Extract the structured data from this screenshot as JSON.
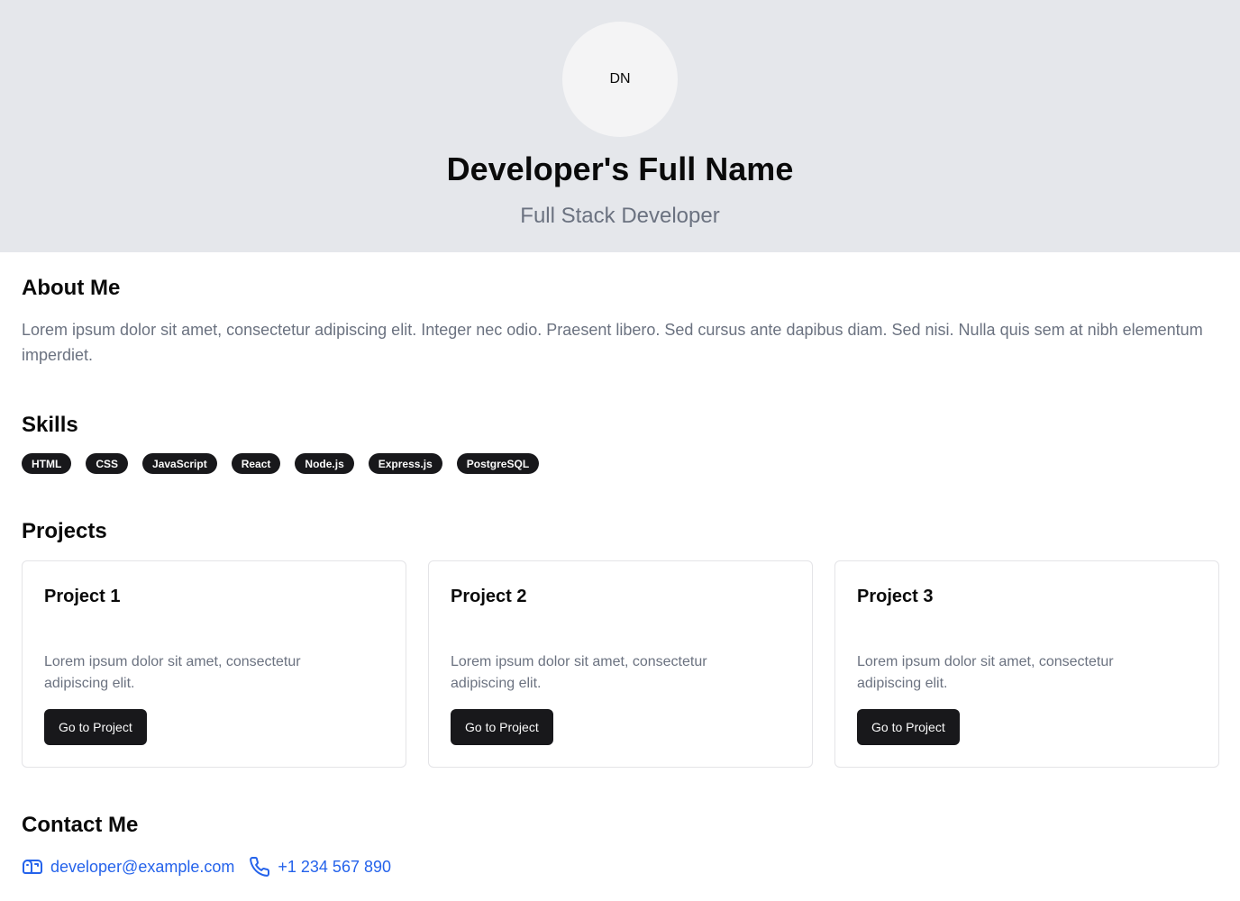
{
  "header": {
    "avatar_initials": "DN",
    "name": "Developer's Full Name",
    "role": "Full Stack Developer"
  },
  "about": {
    "title": "About Me",
    "text": "Lorem ipsum dolor sit amet, consectetur adipiscing elit. Integer nec odio. Praesent libero. Sed cursus ante dapibus diam. Sed nisi. Nulla quis sem at nibh elementum imperdiet."
  },
  "skills": {
    "title": "Skills",
    "items": [
      "HTML",
      "CSS",
      "JavaScript",
      "React",
      "Node.js",
      "Express.js",
      "PostgreSQL"
    ]
  },
  "projects": {
    "title": "Projects",
    "items": [
      {
        "title": "Project 1",
        "description": "Lorem ipsum dolor sit amet, consectetur adipiscing elit.",
        "button_label": "Go to Project"
      },
      {
        "title": "Project 2",
        "description": "Lorem ipsum dolor sit amet, consectetur adipiscing elit.",
        "button_label": "Go to Project"
      },
      {
        "title": "Project 3",
        "description": "Lorem ipsum dolor sit amet, consectetur adipiscing elit.",
        "button_label": "Go to Project"
      }
    ]
  },
  "contact": {
    "title": "Contact Me",
    "email": "developer@example.com",
    "email_icon": "mailbox-icon",
    "phone": "+1 234 567 890",
    "phone_icon": "phone-icon"
  },
  "colors": {
    "hero_background": "#e5e7eb",
    "primary": "#18181b",
    "link": "#2563eb",
    "muted_text": "#6b7280"
  }
}
